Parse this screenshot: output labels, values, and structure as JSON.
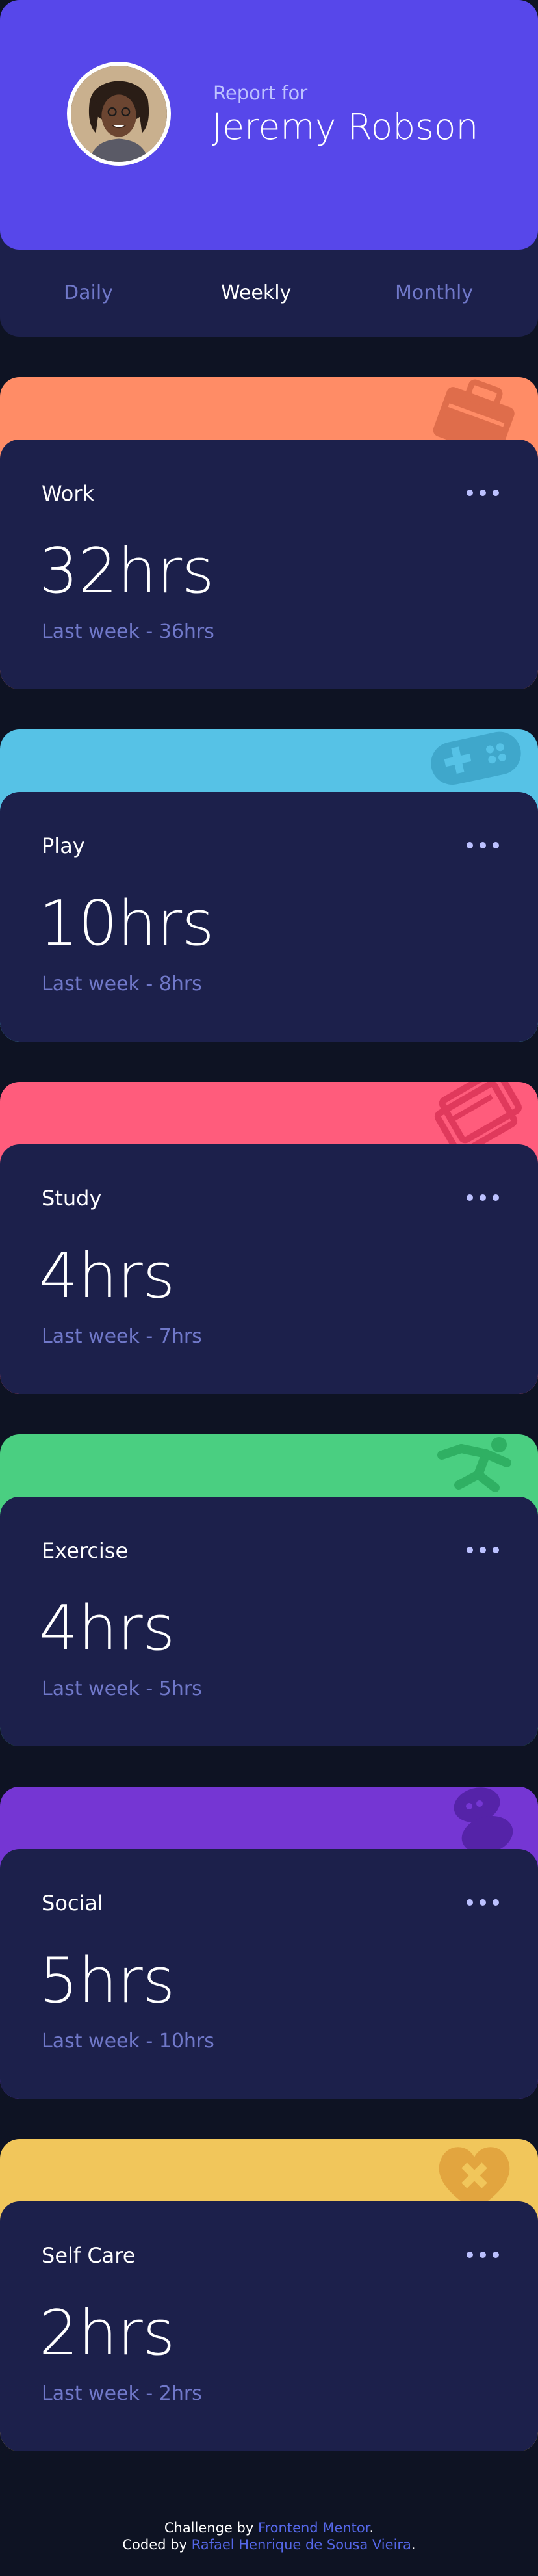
{
  "profile": {
    "report_for": "Report for",
    "name": "Jeremy Robson",
    "accent_color": "#5747ea"
  },
  "periods": [
    {
      "label": "Daily",
      "active": false
    },
    {
      "label": "Weekly",
      "active": true
    },
    {
      "label": "Monthly",
      "active": false
    }
  ],
  "activities": [
    {
      "title": "Work",
      "current": "32hrs",
      "previous": "Last week - 36hrs",
      "color": "#ff8c66",
      "icon": "briefcase-icon"
    },
    {
      "title": "Play",
      "current": "10hrs",
      "previous": "Last week - 8hrs",
      "color": "#56c2e6",
      "icon": "gamepad-icon"
    },
    {
      "title": "Study",
      "current": "4hrs",
      "previous": "Last week - 7hrs",
      "color": "#ff5c7c",
      "icon": "books-icon"
    },
    {
      "title": "Exercise",
      "current": "4hrs",
      "previous": "Last week - 5hrs",
      "color": "#4acf81",
      "icon": "runner-icon"
    },
    {
      "title": "Social",
      "current": "5hrs",
      "previous": "Last week - 10hrs",
      "color": "#7536d3",
      "icon": "chat-bubbles-icon"
    },
    {
      "title": "Self Care",
      "current": "2hrs",
      "previous": "Last week - 2hrs",
      "color": "#f1c65b",
      "icon": "heart-bandage-icon"
    }
  ],
  "footer": {
    "challenge_prefix": "Challenge by ",
    "challenge_link": "Frontend Mentor",
    "challenge_suffix": ".",
    "coded_prefix": "Coded by ",
    "coded_link": "Rafael Henrique de Sousa Vieira",
    "coded_suffix": "."
  },
  "colors": {
    "background": "#0e1323",
    "card": "#1c204b",
    "muted_text": "#7078c9"
  }
}
